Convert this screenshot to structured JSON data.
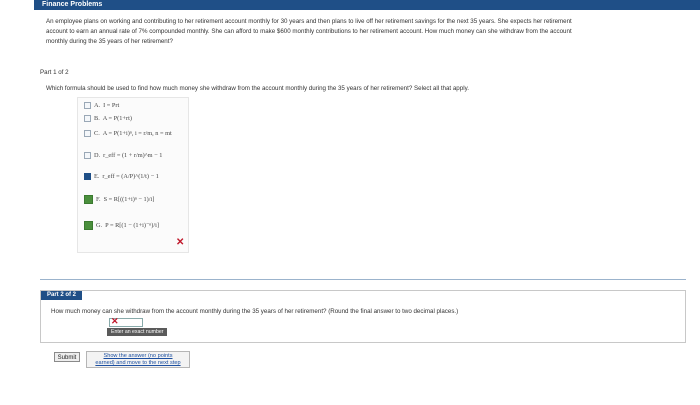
{
  "header": {
    "title": "Finance Problems"
  },
  "problem": {
    "line1": "An employee plans on working and contributing to her retirement account monthly for 30 years and then plans to live off her retirement savings for the next 35 years. She expects her retirement",
    "line2": "account to earn an annual rate of 7% compounded monthly. She can afford to make $600 monthly contributions to her retirement account. How much money can she withdraw from the account",
    "line3": "monthly during the 35 years of her retirement?"
  },
  "part1": {
    "label": "Part 1 of 2",
    "question": "Which formula should be used to find how much money she withdraw from the account monthly during the 35 years of her retirement? Select all that apply.",
    "options": [
      {
        "letter": "A.",
        "formula": "I = Prt",
        "checked": false
      },
      {
        "letter": "B.",
        "formula": "A = P(1+rt)",
        "checked": false
      },
      {
        "letter": "C.",
        "formula": "A = P(1+i)ⁿ, i = r/m, n = mt",
        "checked": false
      },
      {
        "letter": "D.",
        "formula": "r_eff = (1 + r/m)^m − 1",
        "checked": false
      },
      {
        "letter": "E.",
        "formula": "r_eff = (A/P)^(1/t) − 1",
        "checked": true
      },
      {
        "letter": "F.",
        "formula": "S = R[((1+i)ⁿ − 1)/i]",
        "checked": false
      },
      {
        "letter": "G.",
        "formula": "P = R[(1 − (1+i)⁻ⁿ)/i]",
        "checked": false
      }
    ]
  },
  "part2": {
    "tag": "Part 2 of 2",
    "question": "How much money can she withdraw from the account monthly during the 35 years of her retirement? (Round the final answer to two decimal places.)",
    "input_value": "",
    "entry_hint": "Enter an exact number"
  },
  "footer": {
    "submit_label": "Submit",
    "show_answer_line1": "Show the answer (no points",
    "show_answer_line2": "earned) and move to the next step"
  },
  "colors": {
    "accent": "#1f4f87",
    "error": "#c0182b"
  }
}
